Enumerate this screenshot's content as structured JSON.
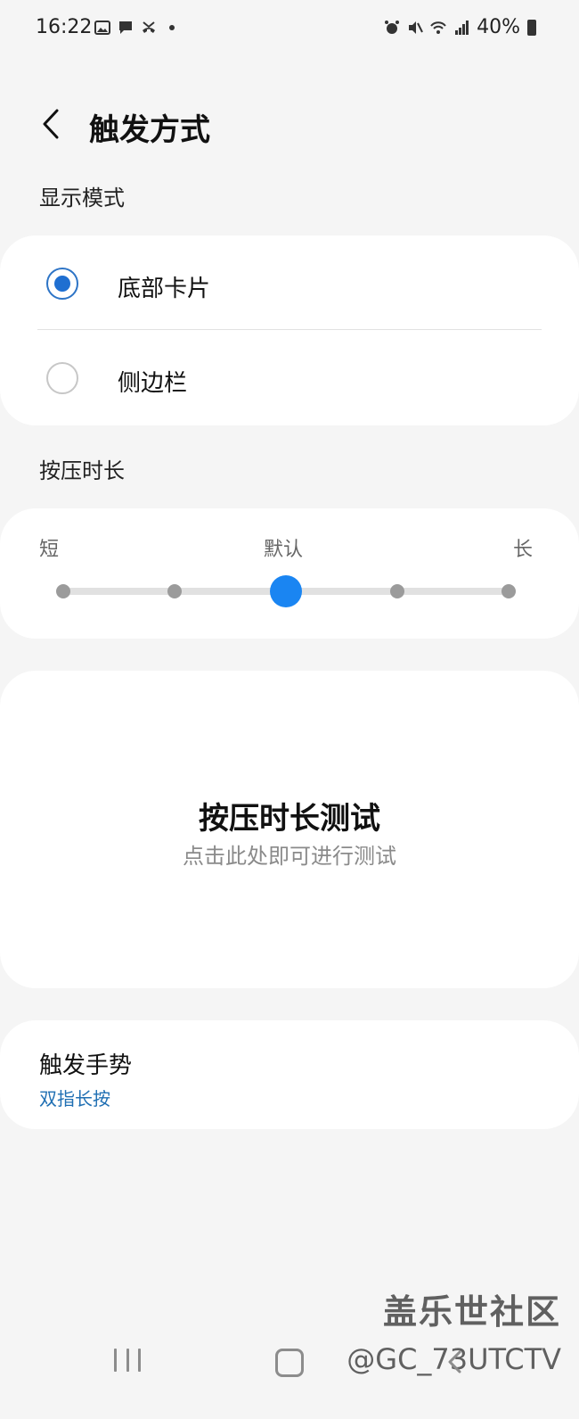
{
  "status_bar": {
    "time": "16:22",
    "battery": "40%",
    "left_icons": [
      "image-icon",
      "message-icon",
      "missed-call-icon",
      "dot-icon"
    ],
    "right_icons": [
      "alarm-icon",
      "mute-icon",
      "wifi-icon",
      "signal-icon",
      "battery-icon"
    ]
  },
  "header": {
    "title": "触发方式",
    "back_icon": "chevron-left-icon"
  },
  "display_mode": {
    "label": "显示模式",
    "options": [
      {
        "label": "底部卡片",
        "checked": true
      },
      {
        "label": "侧边栏",
        "checked": false
      }
    ]
  },
  "press_duration": {
    "label": "按压时长",
    "slider": {
      "min_label": "短",
      "default_label": "默认",
      "max_label": "长",
      "steps": 5,
      "selected_index": 2
    }
  },
  "test_card": {
    "title": "按压时长测试",
    "subtitle": "点击此处即可进行测试"
  },
  "gesture": {
    "title": "触发手势",
    "value": "双指长按"
  },
  "watermark": {
    "line1": "盖乐世社区",
    "line2": "@GC_73UTCTV"
  },
  "colors": {
    "accent": "#1a85f2",
    "radio_checked": "#1f6fd1",
    "link_blue": "#1f6fb3",
    "background": "#f5f5f5",
    "card": "#ffffff"
  }
}
